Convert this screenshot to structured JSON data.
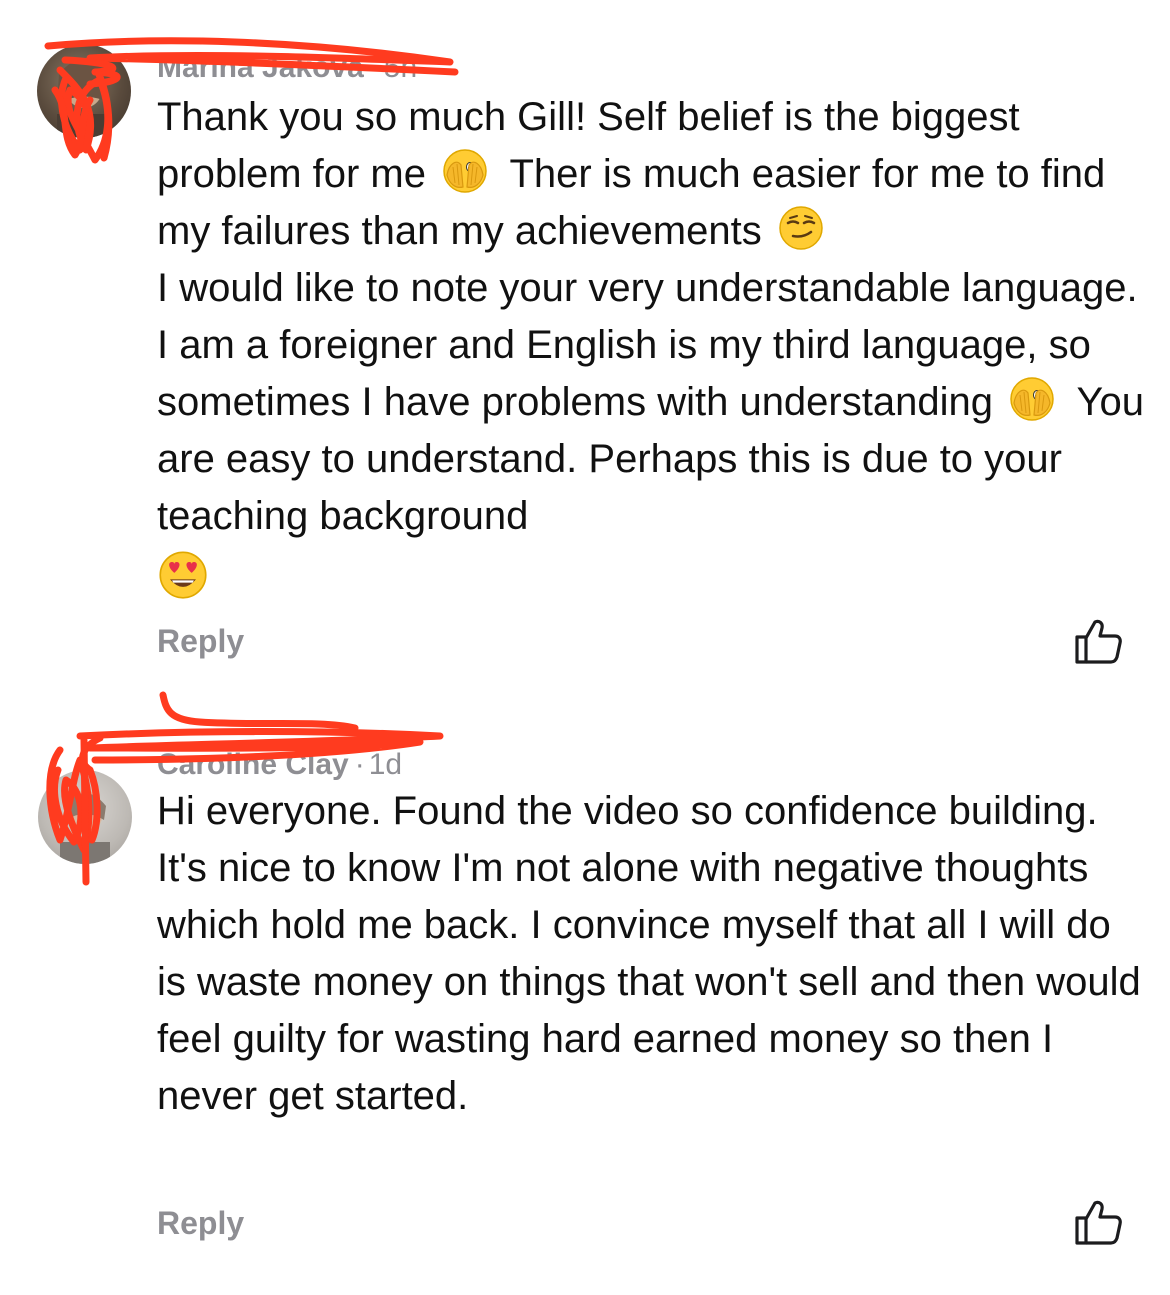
{
  "comments": [
    {
      "author": "Marina Jakova",
      "time": "5h",
      "paragraph_1_part_1": "Thank you so much Gill! Self belief is the biggest problem for me",
      "emoji_1": "face-with-open-eyes-and-hand-over-mouth",
      "paragraph_1_part_2": "Ther is much easier for me to find my failures than my achievements",
      "emoji_2": "smirking-face",
      "paragraph_2_part_1": "I would like to note your very understandable language. I am a foreigner and English is my third language, so sometimes I have problems with understanding",
      "emoji_3": "face-with-open-eyes-and-hand-over-mouth",
      "paragraph_2_part_2": "You are easy to understand. Perhaps this is due to your teaching background",
      "emoji_4": "smiling-face-with-heart-eyes",
      "reply_label": "Reply",
      "like_icon": "thumbs-up-icon"
    },
    {
      "author": "Caroline Clay",
      "time": "1d",
      "text": "Hi everyone. Found the video so confidence building. It's nice to know I'm not alone with negative thoughts which hold me back. I convince myself that all I will do is waste money on things that won't sell and then would feel guilty for wasting hard earned money so then I never get started.",
      "reply_label": "Reply",
      "like_icon": "thumbs-up-icon"
    }
  ],
  "colors": {
    "text": "#111111",
    "meta": "#8e8e93",
    "redaction": "#ff3b1f",
    "emoji_yellow": "#ffcc33"
  }
}
